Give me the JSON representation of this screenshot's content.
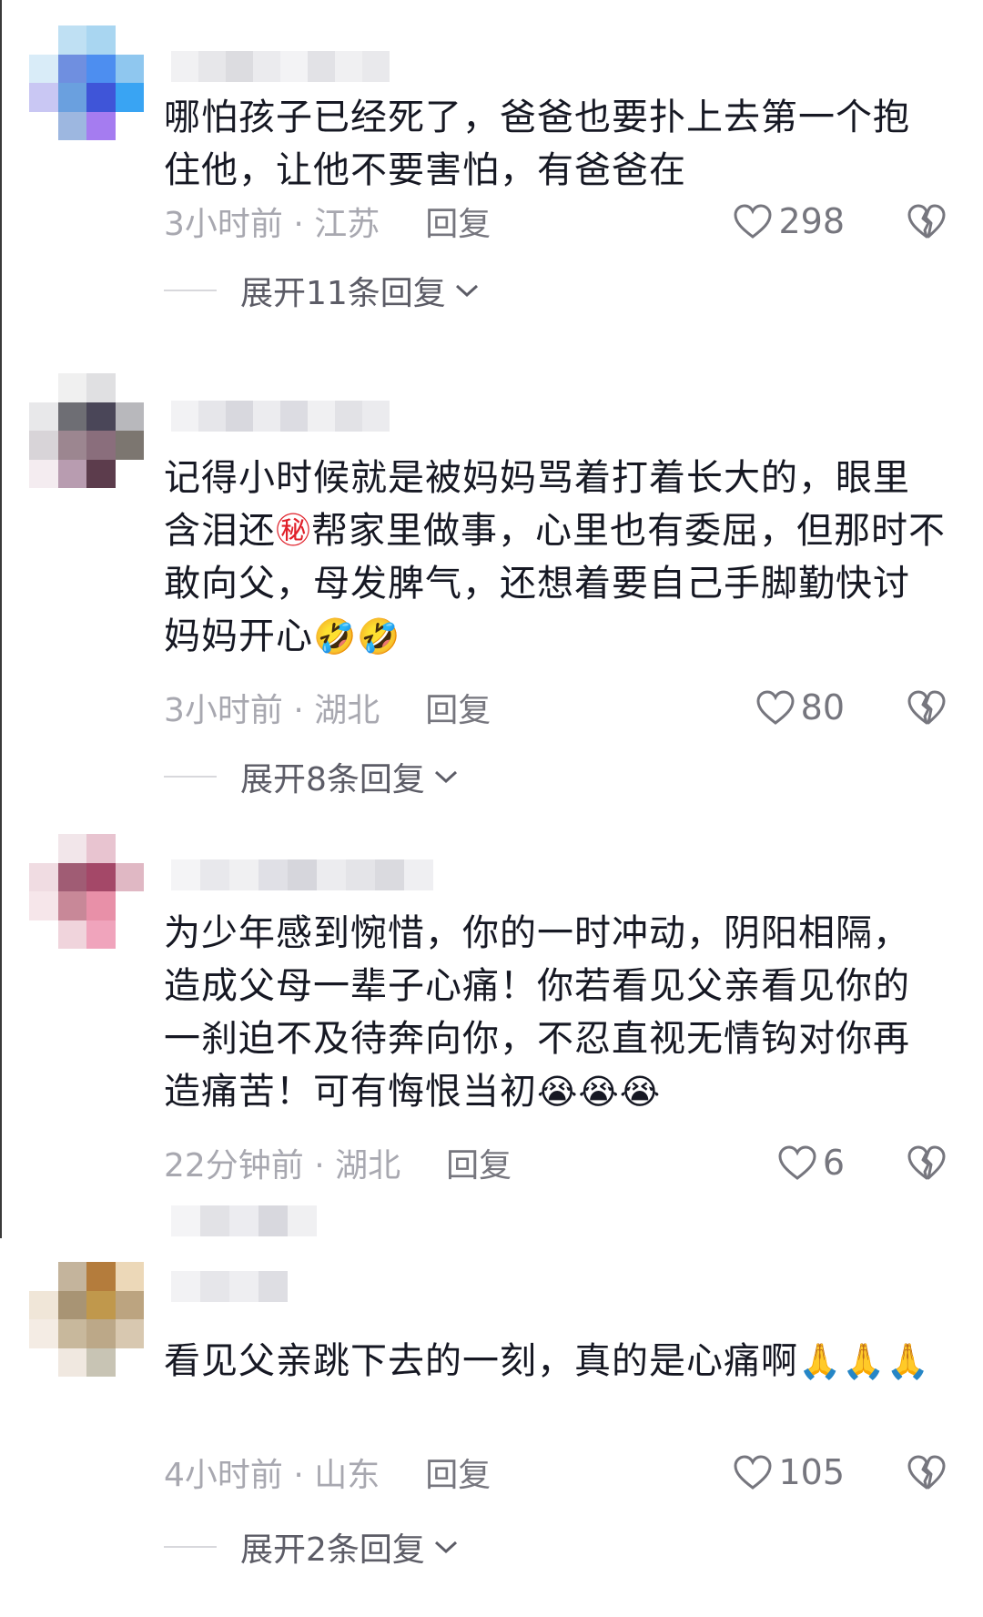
{
  "comments": [
    {
      "text": "哪怕孩子已经死了，爸爸也要扑上去第一个抱住他，让他不要害怕，有爸爸在",
      "time_location": "3小时前 · 江苏",
      "reply_label": "回复",
      "likes": "298",
      "expand_label": "展开11条回复"
    },
    {
      "text": "记得小时候就是被妈妈骂着打着长大的，眼里含泪还",
      "text_emoji_1": "㊙",
      "text_after": "帮家里做事，心里也有委屈，但那时不敢向父，母发脾气，还想着要自己手脚勤快讨妈妈开心",
      "text_emoji_2": "🤣🤣",
      "time_location": "3小时前 · 湖北",
      "reply_label": "回复",
      "likes": "80",
      "expand_label": "展开8条回复"
    },
    {
      "text": "为少年感到惋惜，你的一时冲动，阴阳相隔，造成父母一辈子心痛！你若看见父亲看见你的一刹迫不及待奔向你，不忍直视无情钩对你再造痛苦！可有悔恨当初",
      "text_emoji": "😭😭😭",
      "time_location": "22分钟前 · 湖北",
      "reply_label": "回复",
      "likes": "6"
    },
    {
      "text": "看见父亲跳下去的一刻，真的是心痛啊",
      "text_emoji": "🙏🙏🙏",
      "time_location": "4小时前 · 山东",
      "reply_label": "回复",
      "likes": "105",
      "expand_label": "展开2条回复"
    }
  ],
  "icons": {
    "like": "heart-outline-icon",
    "dislike": "broken-heart-icon",
    "expand": "chevron-down-icon"
  },
  "colors": {
    "text": "#161823",
    "meta": "#a8a8b0",
    "secondary": "#76767e"
  }
}
